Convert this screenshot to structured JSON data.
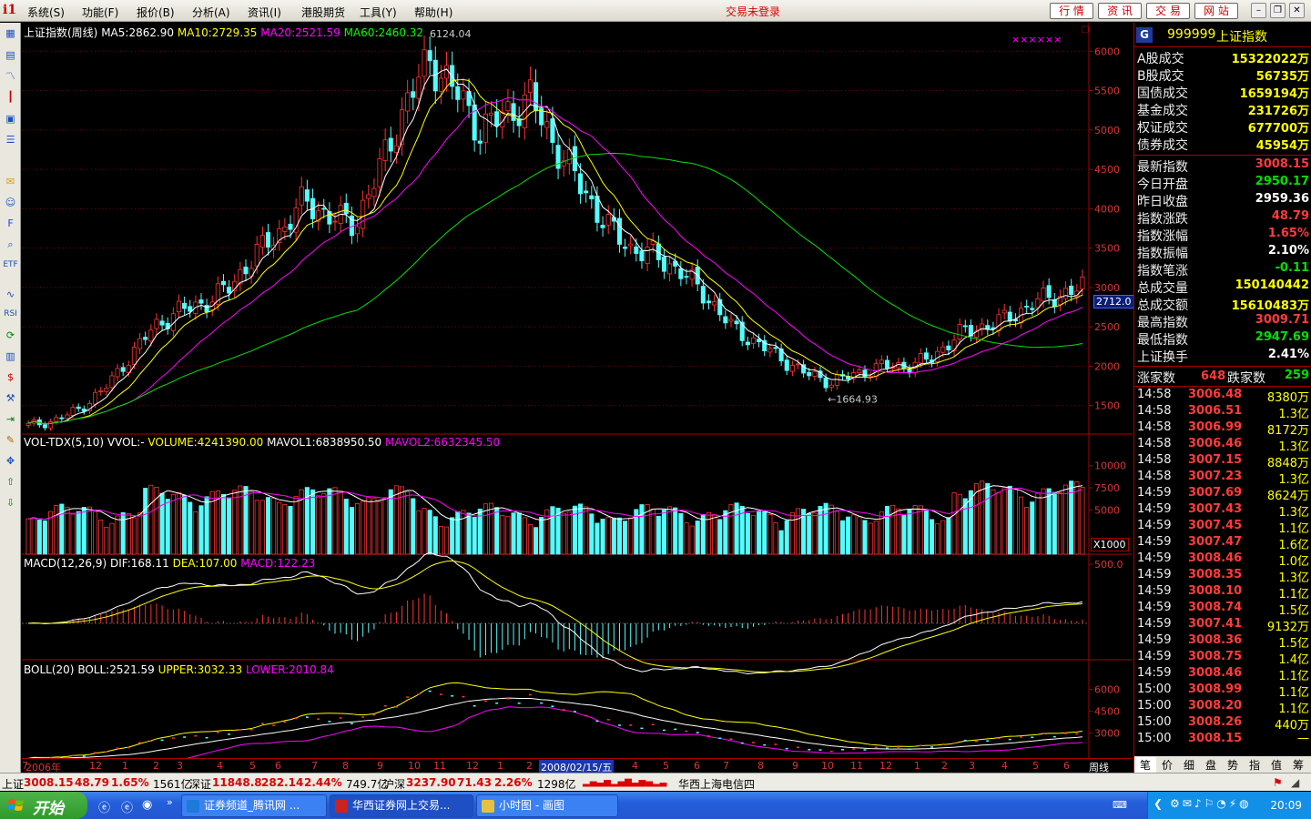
{
  "menu": {
    "items": [
      "系统(S)",
      "功能(F)",
      "报价(B)",
      "分析(A)",
      "资讯(I)",
      "港股期货",
      "工具(Y)",
      "帮助(H)"
    ],
    "trade_status": "交易未登录",
    "buttons": [
      "行 情",
      "资 讯",
      "交 易",
      "网 站"
    ]
  },
  "chart": {
    "header": {
      "index": "上证指数(周线)",
      "ma5": "MA5:2862.90",
      "ma10": "MA10:2729.35",
      "ma20": "MA20:2521.59",
      "ma60": "MA60:2460.32"
    },
    "price_axis": [
      "6000",
      "5500",
      "5000",
      "4500",
      "4000",
      "3500",
      "3000",
      "2500",
      "2000",
      "1500"
    ],
    "current_price_label": "2712.0",
    "high_label": "6124.04",
    "low_label": "1664.93",
    "marker": "××××××",
    "vol_header": {
      "name": "VOL-TDX(5,10)",
      "vvol": "VVOL:-",
      "volume": "VOLUME:4241390.00",
      "mavol1": "MAVOL1:6838950.50",
      "mavol2": "MAVOL2:6632345.50"
    },
    "vol_axis": [
      "10000",
      "7500",
      "5000"
    ],
    "vol_unit": "X1000",
    "macd_header": {
      "name": "MACD(12,26,9)",
      "dif": "DIF:168.11",
      "dea": "DEA:107.00",
      "macd": "MACD:122.23"
    },
    "macd_axis": [
      "500.0"
    ],
    "boll_header": {
      "name": "BOLL(20)",
      "boll": "BOLL:2521.59",
      "upper": "UPPER:3032.33",
      "lower": "LOWER:2010.84"
    },
    "boll_axis": [
      "6000",
      "4500",
      "3000"
    ],
    "date_labels": [
      "2006年",
      "12",
      "1",
      "2",
      "3",
      "4",
      "5",
      "6",
      "7",
      "8",
      "9",
      "10",
      "11",
      "12",
      "1",
      "2",
      "2008/02/15/五",
      "4",
      "5",
      "6",
      "7",
      "8",
      "9",
      "10",
      "11",
      "12",
      "1",
      "2",
      "3",
      "4",
      "5",
      "6",
      "7"
    ],
    "date_suffix": "周线"
  },
  "chart_data": {
    "type": "candlestick",
    "title": "上证指数(周线)",
    "period": "weekly",
    "high": 6124.04,
    "low": 1664.93,
    "ylim": [
      1300,
      6200
    ],
    "weekly_close_approx": [
      1250,
      1300,
      1450,
      1700,
      2100,
      2500,
      2700,
      2800,
      3000,
      3400,
      3700,
      4100,
      3900,
      3800,
      4500,
      5300,
      5900,
      5500,
      5000,
      5200,
      5400,
      4800,
      4300,
      3800,
      3500,
      3400,
      3200,
      2900,
      2500,
      2300,
      2100,
      1900,
      1800,
      1900,
      2000,
      2000,
      2100,
      2400,
      2500,
      2600,
      2800,
      2900,
      3000
    ],
    "ma5": 2862.9,
    "ma10": 2729.35,
    "ma20": 2521.59,
    "ma60": 2460.32,
    "volume": {
      "VOLUME": 4241390.0,
      "MAVOL1": 6838950.5,
      "MAVOL2": 6632345.5
    },
    "macd": {
      "DIF": 168.11,
      "DEA": 107.0,
      "MACD": 122.23
    },
    "boll": {
      "BOLL": 2521.59,
      "UPPER": 3032.33,
      "LOWER": 2010.84
    }
  },
  "panel": {
    "code": "999999",
    "name": "上证指数",
    "turnover": [
      {
        "k": "A股成交",
        "v": "15322022万",
        "c": "#ffff00"
      },
      {
        "k": "B股成交",
        "v": "56735万",
        "c": "#ffff00"
      },
      {
        "k": "国债成交",
        "v": "1659194万",
        "c": "#ffff00"
      },
      {
        "k": "基金成交",
        "v": "231726万",
        "c": "#ffff00"
      },
      {
        "k": "权证成交",
        "v": "677700万",
        "c": "#ffff00"
      },
      {
        "k": "债券成交",
        "v": "45954万",
        "c": "#ffff00"
      }
    ],
    "stats": [
      {
        "k": "最新指数",
        "v": "3008.15",
        "c": "#ff3b3b"
      },
      {
        "k": "今日开盘",
        "v": "2950.17",
        "c": "#00e000"
      },
      {
        "k": "昨日收盘",
        "v": "2959.36",
        "c": "#ffffff"
      },
      {
        "k": "指数涨跌",
        "v": "48.79",
        "c": "#ff3b3b"
      },
      {
        "k": "指数涨幅",
        "v": "1.65%",
        "c": "#ff3b3b"
      },
      {
        "k": "指数振幅",
        "v": "2.10%",
        "c": "#ffffff"
      },
      {
        "k": "指数笔涨",
        "v": "-0.11",
        "c": "#00e000"
      },
      {
        "k": "总成交量",
        "v": "150140442",
        "c": "#ffff00"
      },
      {
        "k": "总成交额",
        "v": "15610483万",
        "c": "#ffff00"
      },
      {
        "k": "最高指数",
        "v": "3009.71",
        "c": "#ff3b3b"
      },
      {
        "k": "最低指数",
        "v": "2947.69",
        "c": "#00e000"
      },
      {
        "k": "上证换手",
        "v": "2.41%",
        "c": "#ffffff"
      }
    ],
    "breadth": {
      "up_label": "涨家数",
      "up": "648",
      "down_label": "跌家数",
      "down": "259"
    },
    "ticks": [
      [
        "14:58",
        "3006.48",
        "8380万"
      ],
      [
        "14:58",
        "3006.51",
        "1.3亿"
      ],
      [
        "14:58",
        "3006.99",
        "8172万"
      ],
      [
        "14:58",
        "3006.46",
        "1.3亿"
      ],
      [
        "14:58",
        "3007.15",
        "8848万"
      ],
      [
        "14:58",
        "3007.23",
        "1.3亿"
      ],
      [
        "14:59",
        "3007.69",
        "8624万"
      ],
      [
        "14:59",
        "3007.43",
        "1.3亿"
      ],
      [
        "14:59",
        "3007.45",
        "1.1亿"
      ],
      [
        "14:59",
        "3007.47",
        "1.6亿"
      ],
      [
        "14:59",
        "3008.46",
        "1.0亿"
      ],
      [
        "14:59",
        "3008.35",
        "1.3亿"
      ],
      [
        "14:59",
        "3008.10",
        "1.1亿"
      ],
      [
        "14:59",
        "3008.74",
        "1.5亿"
      ],
      [
        "14:59",
        "3007.41",
        "9132万"
      ],
      [
        "14:59",
        "3008.36",
        "1.5亿"
      ],
      [
        "14:59",
        "3008.75",
        "1.4亿"
      ],
      [
        "14:59",
        "3008.46",
        "1.1亿"
      ],
      [
        "15:00",
        "3008.99",
        "1.1亿"
      ],
      [
        "15:00",
        "3008.20",
        "1.1亿"
      ],
      [
        "15:00",
        "3008.26",
        "440万"
      ],
      [
        "15:00",
        "3008.15",
        "—"
      ]
    ],
    "tabs": [
      "笔",
      "价",
      "细",
      "盘",
      "势",
      "指",
      "值",
      "筹"
    ]
  },
  "status": {
    "sh_label": "上证",
    "sh_price": "3008.15",
    "sh_chg": "48.79",
    "sh_pct": "1.65%",
    "sh_amt": "1561亿",
    "sz_label": "深证",
    "sz_price": "11848.8",
    "sz_chg": "282.14",
    "sz_pct": "2.44%",
    "sz_amt": "749.7亿",
    "hs_label": "沪深",
    "hs_price": "3237.90",
    "hs_chg": "71.43",
    "hs_pct": "2.26%",
    "hs_amt": "1298亿",
    "broker": "华西上海电信四"
  },
  "taskbar": {
    "start": "开始",
    "tasks": [
      "证券频道_腾讯网 ...",
      "华西证券网上交易...",
      "小时图 - 画图"
    ],
    "clock": "20:09"
  }
}
